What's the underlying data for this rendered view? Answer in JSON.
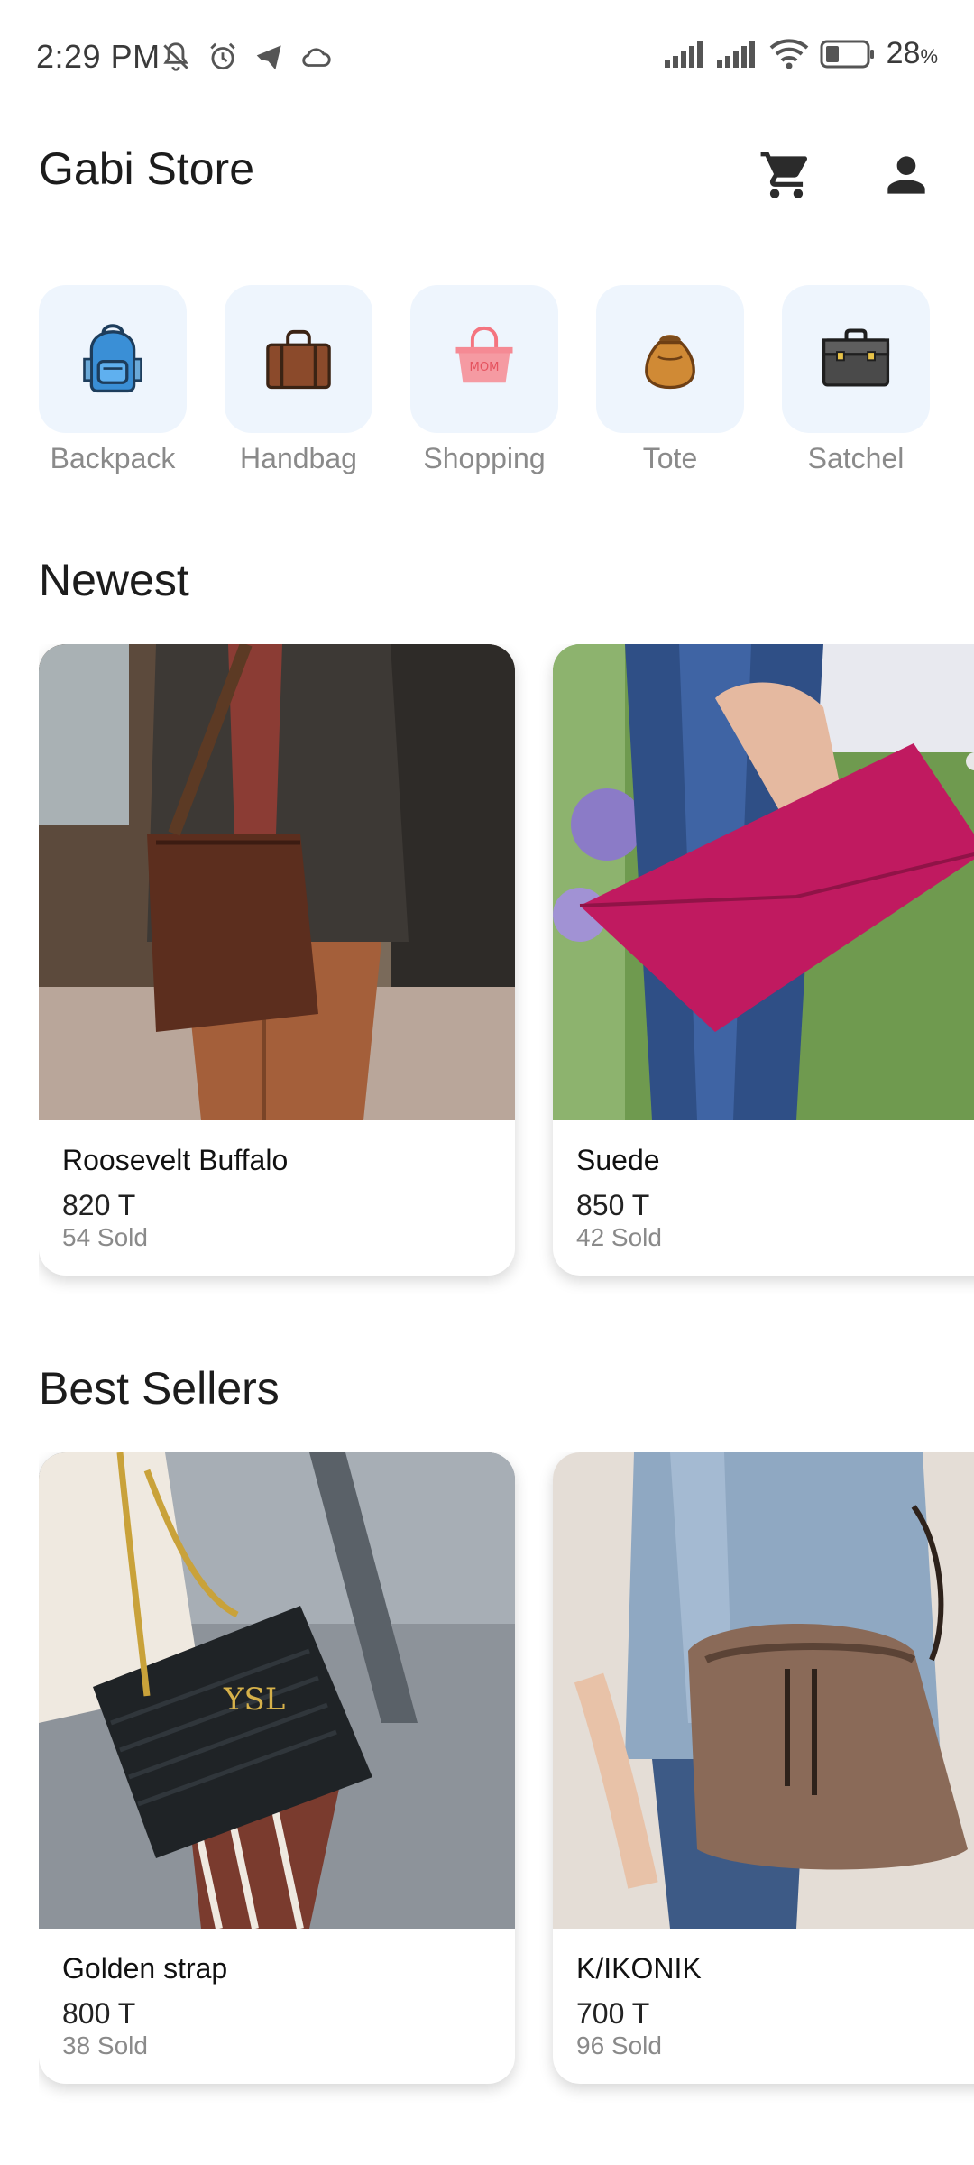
{
  "status_bar": {
    "time": "2:29 PM",
    "icons": [
      "bell-off-icon",
      "alarm-icon",
      "telegram-icon",
      "cloud-icon",
      "signal-icon",
      "signal-icon",
      "wifi-icon",
      "battery-icon"
    ],
    "battery_percent": "28",
    "battery_suffix": "%"
  },
  "app_bar": {
    "title": "Gabi Store",
    "cart_icon": "cart-icon",
    "account_icon": "account-icon"
  },
  "categories": [
    {
      "label": "Backpack",
      "icon": "backpack-icon",
      "color": "#3a8fd6"
    },
    {
      "label": "Handbag",
      "icon": "handbag-icon",
      "color": "#8b4a2b"
    },
    {
      "label": "Shopping",
      "icon": "shopping-bag-icon",
      "color": "#f28b96"
    },
    {
      "label": "Tote",
      "icon": "tote-icon",
      "color": "#c9832f"
    },
    {
      "label": "Satchel",
      "icon": "satchel-icon",
      "color": "#4a4a4a"
    }
  ],
  "sections": {
    "newest": {
      "title": "Newest",
      "products": [
        {
          "name": "Roosevelt Buffalo",
          "price": "820 T",
          "sold": "54 Sold"
        },
        {
          "name": "Suede",
          "price": "850 T",
          "sold": "42 Sold"
        }
      ]
    },
    "best_sellers": {
      "title": "Best Sellers",
      "products": [
        {
          "name": "Golden strap",
          "price": "800 T",
          "sold": "38 Sold"
        },
        {
          "name": "K/IKONIK",
          "price": "700 T",
          "sold": "96 Sold"
        }
      ]
    }
  },
  "colors": {
    "category_tile_bg": "#eef5fd",
    "text_primary": "#1c1c1c",
    "text_secondary": "#8a8a8a"
  }
}
